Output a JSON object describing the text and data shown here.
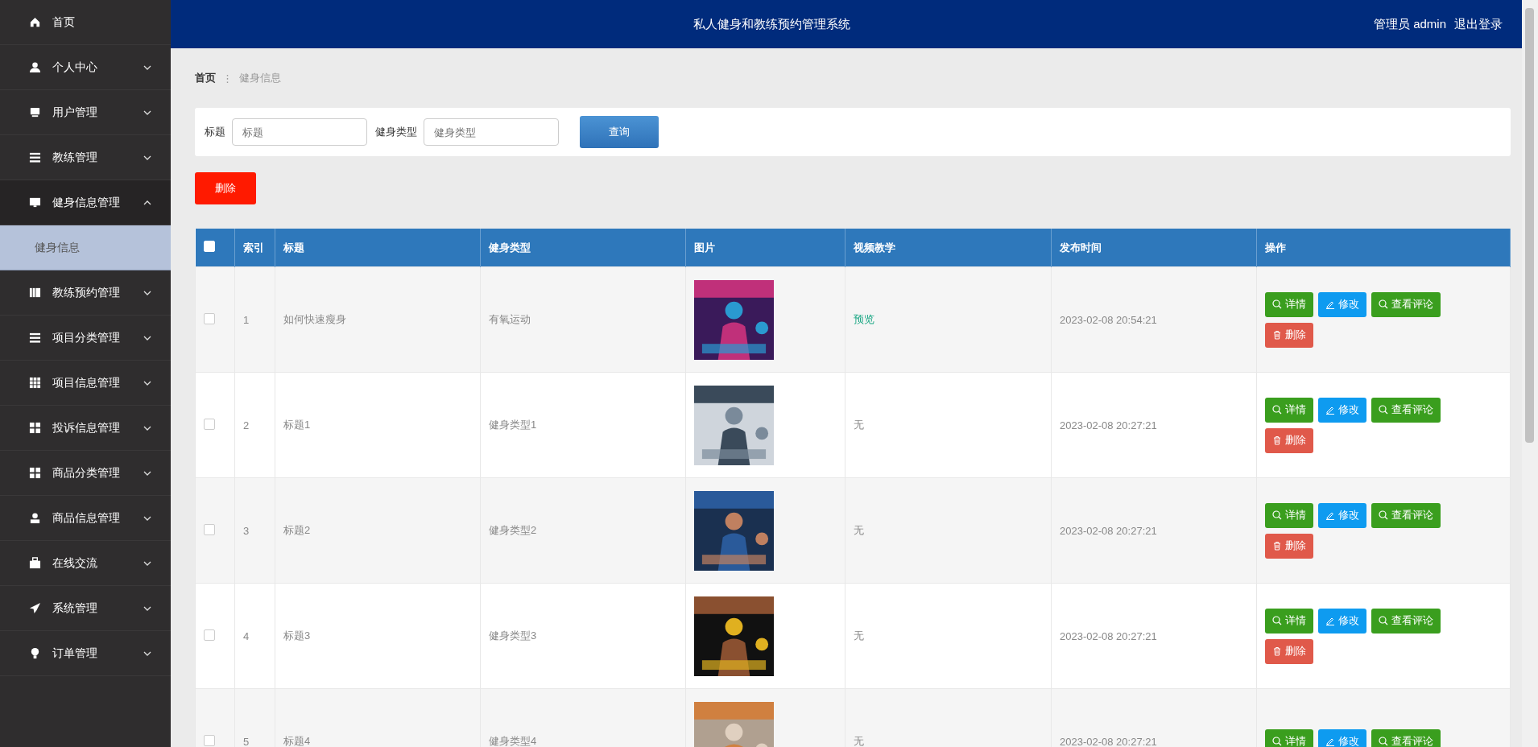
{
  "sidebar": {
    "items": [
      {
        "label": "首页",
        "has_arrow": false
      },
      {
        "label": "个人中心",
        "expanded": false,
        "has_arrow": true
      },
      {
        "label": "用户管理",
        "expanded": false,
        "has_arrow": true
      },
      {
        "label": "教练管理",
        "expanded": false,
        "has_arrow": true
      },
      {
        "label": "健身信息管理",
        "expanded": true,
        "has_arrow": true,
        "children": [
          {
            "label": "健身信息",
            "selected": true
          }
        ]
      },
      {
        "label": "教练预约管理",
        "expanded": false,
        "has_arrow": true
      },
      {
        "label": "项目分类管理",
        "expanded": false,
        "has_arrow": true
      },
      {
        "label": "项目信息管理",
        "expanded": false,
        "has_arrow": true
      },
      {
        "label": "投诉信息管理",
        "expanded": false,
        "has_arrow": true
      },
      {
        "label": "商品分类管理",
        "expanded": false,
        "has_arrow": true
      },
      {
        "label": "商品信息管理",
        "expanded": false,
        "has_arrow": true
      },
      {
        "label": "在线交流",
        "expanded": false,
        "has_arrow": true
      },
      {
        "label": "系统管理",
        "expanded": false,
        "has_arrow": true
      },
      {
        "label": "订单管理",
        "expanded": false,
        "has_arrow": true
      }
    ]
  },
  "header": {
    "title": "私人健身和教练预约管理系统",
    "user": "管理员 admin",
    "logout": "退出登录"
  },
  "breadcrumb": [
    "首页",
    "健身信息"
  ],
  "breadcrumb_separator": "⋮",
  "search": {
    "fields": [
      {
        "label": "标题",
        "placeholder": "标题"
      },
      {
        "label": "健身类型",
        "placeholder": "健身类型"
      }
    ],
    "button": "查询"
  },
  "delete_button": "删除",
  "table": {
    "header_checked": false,
    "columns": [
      "索引",
      "标题",
      "健身类型",
      "图片",
      "视频教学",
      "发布时间",
      "操作"
    ],
    "rows": [
      {
        "checked": false,
        "index": "1",
        "title": "如何快速瘦身",
        "type": "有氧运动",
        "picture": {
          "kind": "picture"
        },
        "video": {
          "kind": "link",
          "text": "预览"
        },
        "time": "2023-02-08 20:54:21",
        "actions": [
          {
            "kind": "detail",
            "label": "详情"
          },
          {
            "kind": "edit",
            "label": "修改"
          },
          {
            "kind": "comment",
            "label": "查看评论"
          },
          {
            "kind": "delete",
            "label": "删除"
          }
        ]
      },
      {
        "checked": false,
        "index": "2",
        "title": "标题1",
        "type": "健身类型1",
        "picture": {
          "kind": "picture"
        },
        "video": {
          "kind": "text",
          "text": "无"
        },
        "time": "2023-02-08 20:27:21",
        "actions": [
          {
            "kind": "detail",
            "label": "详情"
          },
          {
            "kind": "edit",
            "label": "修改"
          },
          {
            "kind": "comment",
            "label": "查看评论"
          },
          {
            "kind": "delete",
            "label": "删除"
          }
        ]
      },
      {
        "checked": false,
        "index": "3",
        "title": "标题2",
        "type": "健身类型2",
        "picture": {
          "kind": "picture"
        },
        "video": {
          "kind": "text",
          "text": "无"
        },
        "time": "2023-02-08 20:27:21",
        "actions": [
          {
            "kind": "detail",
            "label": "详情"
          },
          {
            "kind": "edit",
            "label": "修改"
          },
          {
            "kind": "comment",
            "label": "查看评论"
          },
          {
            "kind": "delete",
            "label": "删除"
          }
        ]
      },
      {
        "checked": false,
        "index": "4",
        "title": "标题3",
        "type": "健身类型3",
        "picture": {
          "kind": "picture"
        },
        "video": {
          "kind": "text",
          "text": "无"
        },
        "time": "2023-02-08 20:27:21",
        "actions": [
          {
            "kind": "detail",
            "label": "详情"
          },
          {
            "kind": "edit",
            "label": "修改"
          },
          {
            "kind": "comment",
            "label": "查看评论"
          },
          {
            "kind": "delete",
            "label": "删除"
          }
        ]
      },
      {
        "checked": false,
        "index": "5",
        "title": "标题4",
        "type": "健身类型4",
        "picture": {
          "kind": "picture"
        },
        "video": {
          "kind": "text",
          "text": "无"
        },
        "time": "2023-02-08 20:27:21",
        "actions": [
          {
            "kind": "detail",
            "label": "详情"
          },
          {
            "kind": "edit",
            "label": "修改"
          },
          {
            "kind": "comment",
            "label": "查看评论"
          }
        ]
      }
    ]
  }
}
